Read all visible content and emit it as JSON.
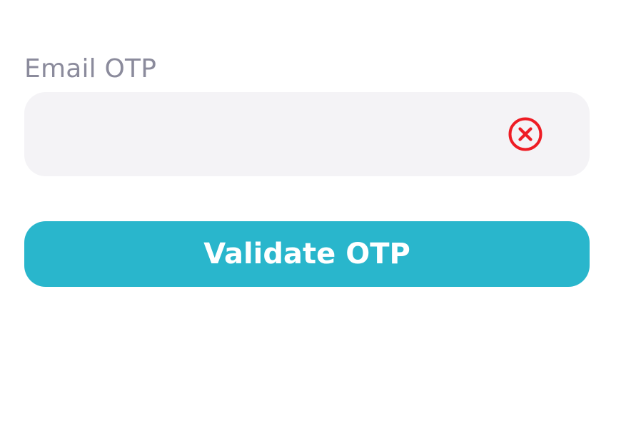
{
  "form": {
    "otp_label": "Email OTP",
    "otp_value": "",
    "otp_placeholder": "",
    "clear_icon": "close-circle-icon",
    "clear_icon_color": "#ee1c24",
    "submit_label": "Validate OTP",
    "submit_color": "#29b6cc",
    "input_background": "#f4f3f6",
    "label_color": "#8b8b9c"
  }
}
